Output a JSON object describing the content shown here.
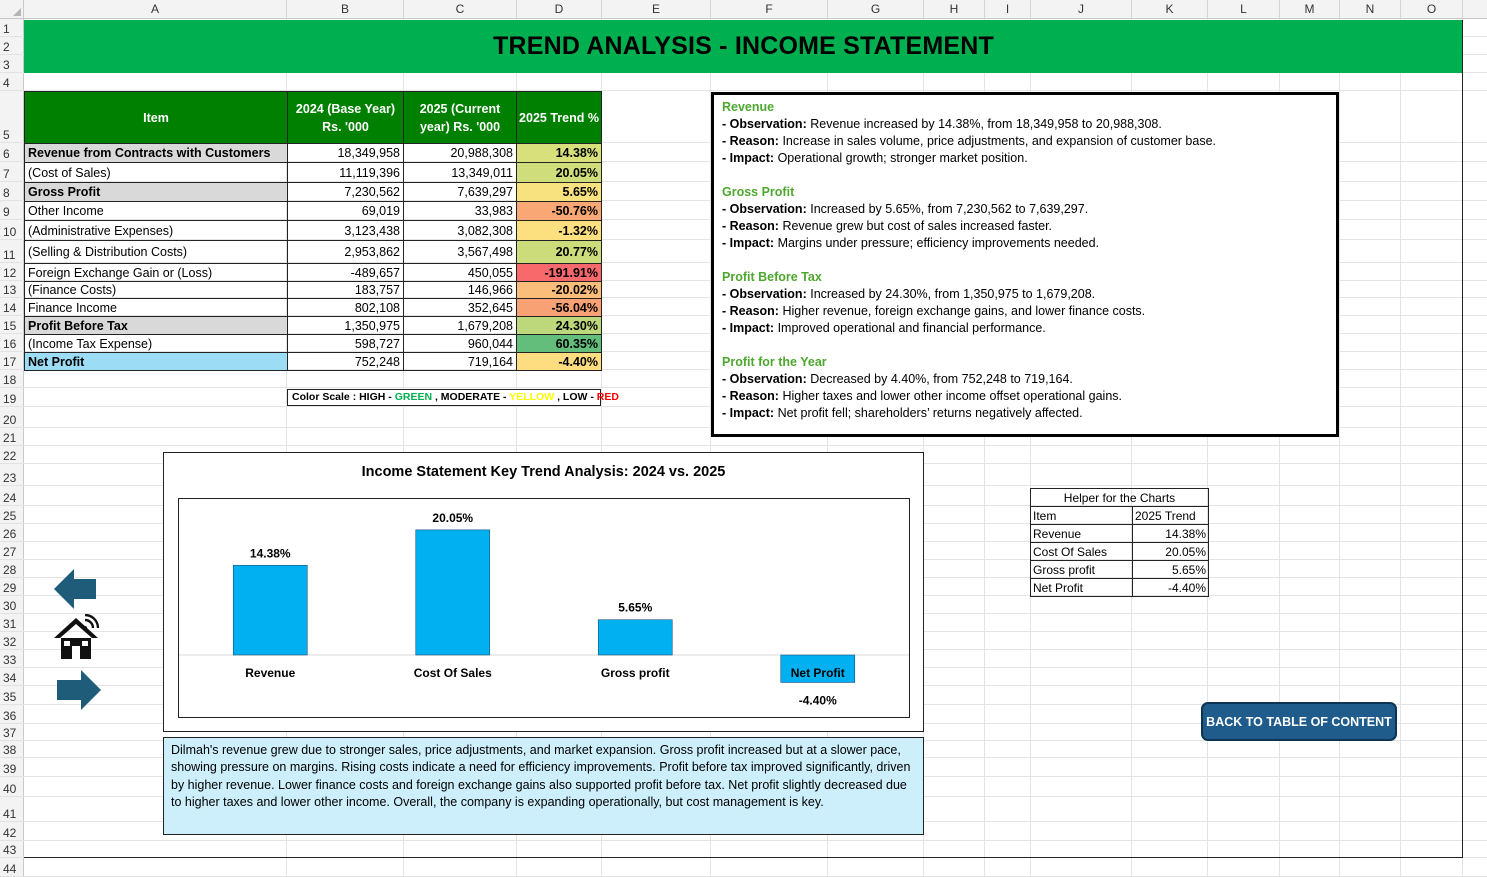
{
  "spreadsheet": {
    "columns": [
      "A",
      "B",
      "C",
      "D",
      "E",
      "F",
      "G",
      "H",
      "I",
      "J",
      "K",
      "L",
      "M",
      "N",
      "O"
    ],
    "rows": [
      "1",
      "2",
      "3",
      "4",
      "5",
      "6",
      "7",
      "8",
      "9",
      "10",
      "11",
      "12",
      "13",
      "14",
      "15",
      "16",
      "17",
      "18",
      "19",
      "20",
      "21",
      "22",
      "23",
      "24",
      "25",
      "26",
      "27",
      "28",
      "29",
      "30",
      "31",
      "32",
      "33",
      "34",
      "35",
      "36",
      "37",
      "38",
      "39",
      "40",
      "41",
      "42",
      "43",
      "44"
    ]
  },
  "title": "TREND ANALYSIS - INCOME STATEMENT",
  "table": {
    "headers": [
      "Item",
      "2024 (Base Year) Rs. '000",
      "2025 (Current year) Rs. '000",
      "2025 Trend %"
    ],
    "rows": [
      {
        "item": "Revenue from Contracts with Customers",
        "y2024": "18,349,958",
        "y2025": "20,988,308",
        "trend": "14.38%",
        "bold": true
      },
      {
        "item": "(Cost of Sales)",
        "y2024": "11,119,396",
        "y2025": "13,349,011",
        "trend": "20.05%",
        "bold": false
      },
      {
        "item": "Gross Profit",
        "y2024": "7,230,562",
        "y2025": "7,639,297",
        "trend": "5.65%",
        "bold": true
      },
      {
        "item": "Other Income",
        "y2024": "69,019",
        "y2025": "33,983",
        "trend": "-50.76%",
        "bold": false
      },
      {
        "item": "(Administrative Expenses)",
        "y2024": "3,123,438",
        "y2025": "3,082,308",
        "trend": "-1.32%",
        "bold": false
      },
      {
        "item": "(Selling & Distribution Costs)",
        "y2024": "2,953,862",
        "y2025": "3,567,498",
        "trend": "20.77%",
        "bold": false
      },
      {
        "item": "Foreign Exchange Gain or (Loss)",
        "y2024": "-489,657",
        "y2025": "450,055",
        "trend": "-191.91%",
        "bold": false
      },
      {
        "item": "(Finance Costs)",
        "y2024": "183,757",
        "y2025": "146,966",
        "trend": "-20.02%",
        "bold": false
      },
      {
        "item": "Finance Income",
        "y2024": "802,108",
        "y2025": "352,645",
        "trend": "-56.04%",
        "bold": false
      },
      {
        "item": "Profit Before Tax",
        "y2024": "1,350,975",
        "y2025": "1,679,208",
        "trend": "24.30%",
        "bold": true
      },
      {
        "item": "(Income Tax Expense)",
        "y2024": "598,727",
        "y2025": "960,044",
        "trend": "60.35%",
        "bold": false
      },
      {
        "item": "Net Profit",
        "y2024": "752,248",
        "y2025": "719,164",
        "trend": "-4.40%",
        "bold": true
      }
    ],
    "trend_colors": [
      "#d8e07c",
      "#cfdd7b",
      "#f8e27f",
      "#f9a875",
      "#fce080",
      "#cddc7a",
      "#f8696b",
      "#fbbd7a",
      "#f8a174",
      "#bcd87a",
      "#63be7b",
      "#fedd81"
    ]
  },
  "color_scale": {
    "label": "Color Scale : HIGH - ",
    "high": "GREEN",
    "mid_label": " , MODERATE - ",
    "mid": "YELLOW",
    "low_label": " , LOW - ",
    "low": "RED",
    "high_color": "#00b050",
    "mid_color": "#ffff00",
    "low_color": "#ff0000"
  },
  "analysis": [
    {
      "heading": "Revenue",
      "observation": "Revenue increased by 14.38%, from 18,349,958 to 20,988,308.",
      "reason": "Increase in sales volume, price adjustments, and expansion of customer base.",
      "impact": "Operational growth; stronger market position."
    },
    {
      "heading": "Gross Profit",
      "observation": "Increased by 5.65%, from 7,230,562 to 7,639,297.",
      "reason": "Revenue grew but cost of sales increased faster.",
      "impact": "Margins under pressure; efficiency improvements needed."
    },
    {
      "heading": "Profit Before Tax",
      "observation": "Increased by 24.30%, from 1,350,975 to 1,679,208.",
      "reason": "Higher revenue, foreign exchange gains, and lower finance costs.",
      "impact": "Improved operational and financial performance."
    },
    {
      "heading": "Profit for the Year",
      "observation": "Decreased by 4.40%, from 752,248 to 719,164.",
      "reason": "Higher taxes and lower other income offset operational gains.",
      "impact": "Net profit fell; shareholders’ returns negatively affected."
    }
  ],
  "analysis_labels": {
    "observation": "- Observation: ",
    "reason": "- Reason: ",
    "impact": "- Impact: "
  },
  "chart_data": {
    "type": "bar",
    "title": "Income Statement Key Trend Analysis: 2024 vs. 2025",
    "categories": [
      "Revenue",
      "Cost Of Sales",
      "Gross profit",
      "Net Profit"
    ],
    "values": [
      14.38,
      20.05,
      5.65,
      -4.4
    ],
    "data_labels": [
      "14.38%",
      "20.05%",
      "5.65%",
      "-4.40%"
    ],
    "bar_color": "#00b0f0",
    "xlabel": "",
    "ylabel": "",
    "ylim": [
      -5,
      22
    ],
    "grid": false
  },
  "helper": {
    "title": "Helper for the Charts",
    "headers": [
      "Item",
      "2025 Trend"
    ],
    "rows": [
      {
        "item": "Revenue",
        "trend": "14.38%"
      },
      {
        "item": "Cost Of Sales",
        "trend": "20.05%"
      },
      {
        "item": "Gross profit",
        "trend": "5.65%"
      },
      {
        "item": "Net Profit",
        "trend": "-4.40%"
      }
    ]
  },
  "nav": {
    "back_icon": "left-arrow-icon",
    "home_icon": "home-icon",
    "next_icon": "right-arrow-icon",
    "icon_color": "#1f5c7a"
  },
  "back_to_toc": "BACK TO TABLE OF CONTENT",
  "summary": "Dilmah's revenue grew due to stronger sales, price adjustments, and market expansion. Gross profit increased but at a slower pace, showing pressure on margins. Rising costs indicate a need for efficiency improvements. Profit before tax improved significantly, driven by higher revenue. Lower finance costs and foreign exchange gains also supported profit before tax. Net profit slightly decreased due to higher taxes and lower other income. Overall, the company is expanding operationally, but cost management is key."
}
